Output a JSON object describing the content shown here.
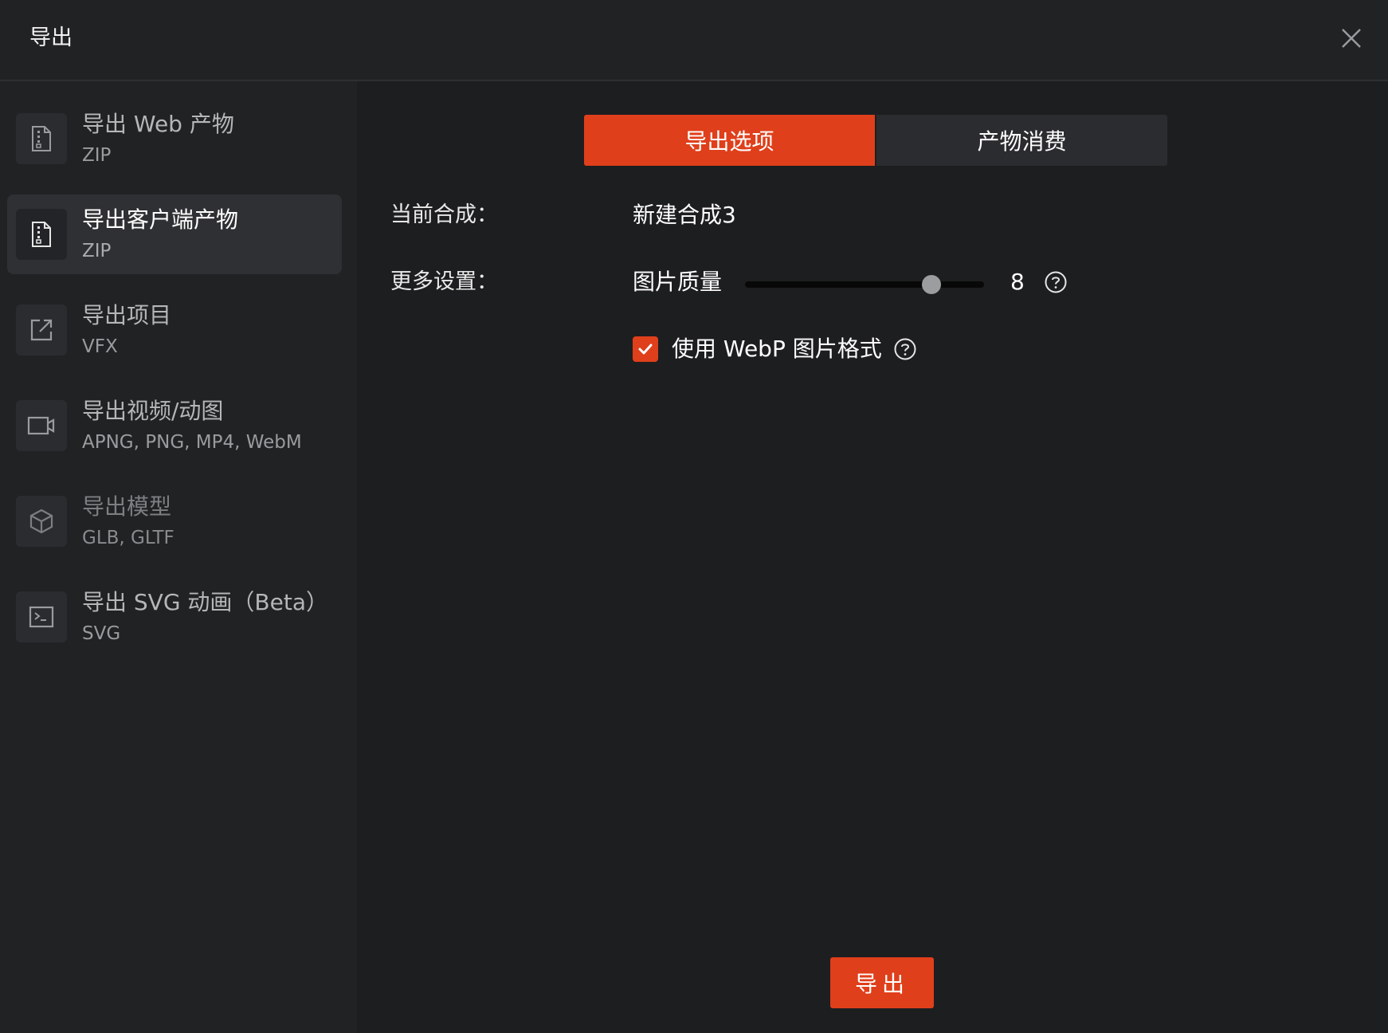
{
  "dialog": {
    "title": "导出",
    "close_icon": "close-icon"
  },
  "sidebar": {
    "items": [
      {
        "title": "导出 Web 产物",
        "subtitle": "ZIP",
        "icon": "zip-file-icon",
        "active": false
      },
      {
        "title": "导出客户端产物",
        "subtitle": "ZIP",
        "icon": "zip-file-icon",
        "active": true
      },
      {
        "title": "导出项目",
        "subtitle": "VFX",
        "icon": "external-link-icon",
        "active": false
      },
      {
        "title": "导出视频/动图",
        "subtitle": "APNG, PNG, MP4, WebM",
        "icon": "video-camera-icon",
        "active": false
      },
      {
        "title": "导出模型",
        "subtitle": "GLB, GLTF",
        "icon": "cube-icon",
        "active": false,
        "dimmed": true
      },
      {
        "title": "导出 SVG 动画（Beta）",
        "subtitle": "SVG",
        "icon": "terminal-icon",
        "active": false
      }
    ]
  },
  "main": {
    "tabs": [
      {
        "label": "导出选项",
        "active": true
      },
      {
        "label": "产物消费",
        "active": false
      }
    ],
    "current_comp": {
      "label": "当前合成：",
      "value": "新建合成3"
    },
    "more_settings": {
      "label": "更多设置：",
      "quality_label": "图片质量",
      "quality_value": "8",
      "quality_fraction": 0.78,
      "webp_checked": true,
      "webp_label": "使用 WebP 图片格式"
    },
    "export_button": "导出"
  },
  "colors": {
    "accent": "#df3f1b",
    "background": "#1d1e20",
    "sidebar": "#212224",
    "active_item": "#2f3033"
  }
}
